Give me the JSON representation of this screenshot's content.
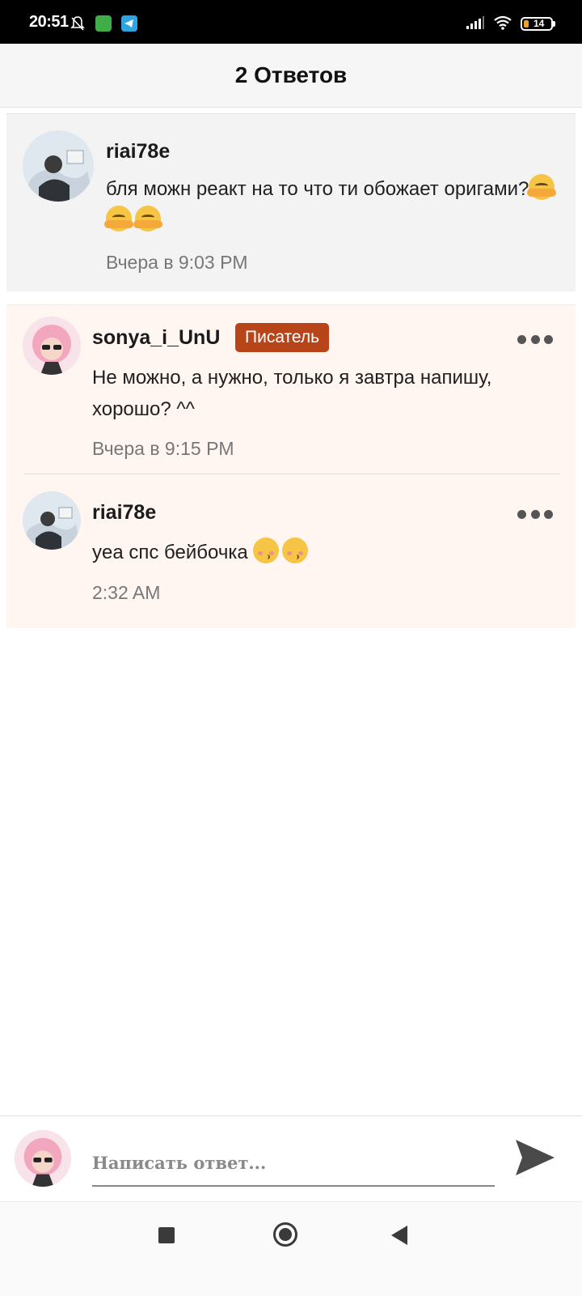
{
  "status_bar": {
    "time": "20:51",
    "battery_level": "14",
    "icons": [
      "bell-off-icon",
      "android-app-icon",
      "telegram-icon",
      "signal-icon",
      "wifi-icon",
      "battery-icon"
    ]
  },
  "header": {
    "title": "2 Ответов"
  },
  "original_comment": {
    "username": "riai78e",
    "text": "бля можн реакт на то что ти обожает оригами?",
    "emoji": [
      "hugging-face-emoji",
      "hugging-face-emoji",
      "hugging-face-emoji"
    ],
    "time": "Вчера в 9:03 PM"
  },
  "replies": [
    {
      "username": "sonya_i_UnU",
      "badge": "Писатель",
      "text": "Не можно, а нужно, только я завтра напишу, хорошо? ^^",
      "time": "Вчера в 9:15 PM"
    },
    {
      "username": "riai78e",
      "text": "yea спс бейбочка",
      "emoji": [
        "kissing-face-emoji",
        "kissing-face-emoji"
      ],
      "time": "2:32 AM"
    }
  ],
  "reply_input": {
    "placeholder": "Написать ответ..."
  },
  "colors": {
    "badge": "#b8451a",
    "replies_background": "#fff6f2",
    "original_background": "#f3f3f4"
  }
}
